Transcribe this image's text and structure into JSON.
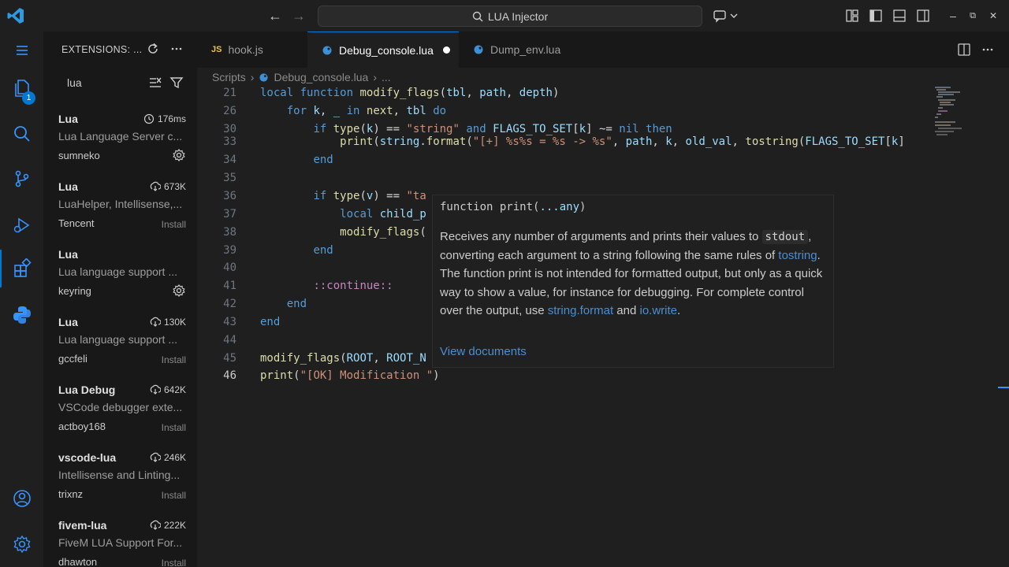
{
  "titlebar": {
    "search_text": "LUA Injector",
    "minimize": "–",
    "restore": "⧉",
    "close": "✕"
  },
  "activity": {
    "extensions_badge": "1"
  },
  "sidebar": {
    "title": "EXTENSIONS: ...",
    "search_value": "lua",
    "extensions": [
      {
        "name": "Lua",
        "meta": "176ms",
        "meta_icon": "history-icon",
        "desc": "Lua Language Server c...",
        "publisher": "sumneko",
        "action": "gear"
      },
      {
        "name": "Lua",
        "meta": "673K",
        "meta_icon": "download-icon",
        "desc": "LuaHelper, Intellisense,...",
        "publisher": "Tencent",
        "action": "Install"
      },
      {
        "name": "Lua",
        "meta": "",
        "meta_icon": "",
        "desc": "Lua language support ...",
        "publisher": "keyring",
        "action": "gear"
      },
      {
        "name": "Lua",
        "meta": "130K",
        "meta_icon": "download-icon",
        "desc": "Lua language support ...",
        "publisher": "gccfeli",
        "action": "Install"
      },
      {
        "name": "Lua Debug",
        "meta": "642K",
        "meta_icon": "download-icon",
        "desc": "VSCode debugger exte...",
        "publisher": "actboy168",
        "action": "Install"
      },
      {
        "name": "vscode-lua",
        "meta": "246K",
        "meta_icon": "download-icon",
        "desc": "Intellisense and Linting...",
        "publisher": "trixnz",
        "action": "Install"
      },
      {
        "name": "fivem-lua",
        "meta": "222K",
        "meta_icon": "download-icon",
        "desc": "FiveM LUA Support For...",
        "publisher": "dhawton",
        "action": "Install"
      }
    ]
  },
  "tabs": [
    {
      "label": "hook.js",
      "type": "js",
      "active": false
    },
    {
      "label": "Debug_console.lua",
      "type": "lua",
      "active": true,
      "dirty": true
    },
    {
      "label": "Dump_env.lua",
      "type": "lua",
      "active": false
    }
  ],
  "breadcrumb": {
    "folder": "Scripts",
    "file": "Debug_console.lua",
    "more": "..."
  },
  "code": {
    "line_numbers": [
      "21",
      "26",
      "30",
      "33",
      "34",
      "35",
      "36",
      "37",
      "38",
      "39",
      "40",
      "41",
      "42",
      "43",
      "44",
      "45",
      "46"
    ]
  },
  "hover": {
    "signature_pre": "function print(",
    "signature_param": "...any",
    "signature_post": ")",
    "body_1": "Receives any number of arguments and prints their values to ",
    "body_code": "stdout",
    "body_2": ", converting each argument to a string following the same rules of ",
    "link_tostring": "tostring",
    "body_3": ". The function print is not intended for formatted output, but only as a quick way to show a value, for instance for debugging. For complete control over the output, use ",
    "link_format": "string.format",
    "body_4": " and ",
    "link_iowrite": "io.write",
    "body_5": ".",
    "view_docs": "View documents"
  }
}
